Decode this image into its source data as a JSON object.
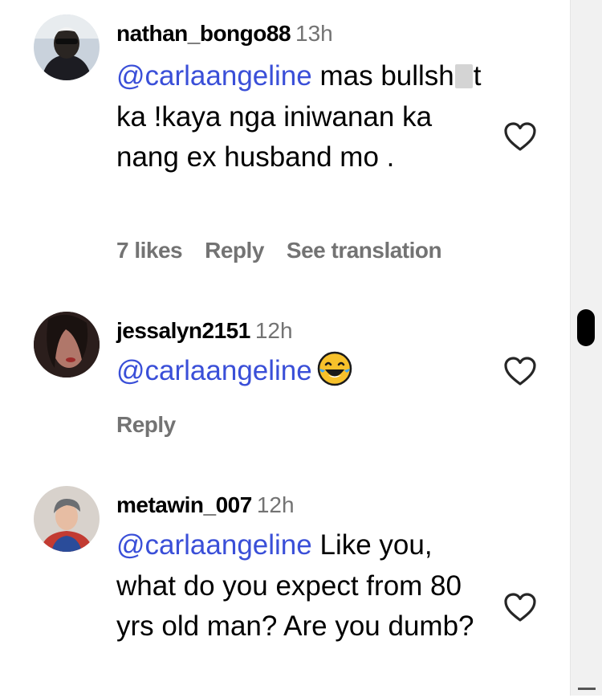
{
  "comments": [
    {
      "username": "nathan_bongo88",
      "time": "13h",
      "mention": "@carlaangeline",
      "text_part1": " mas bullsh",
      "text_part2": "t ka !kaya nga iniwanan ka nang ex husband mo .",
      "likes": "7 likes",
      "reply": "Reply",
      "translation": "See translation"
    },
    {
      "username": "jessalyn2151",
      "time": "12h",
      "mention": "@carlaangeline",
      "emoji": "tears-of-joy-emoji",
      "reply": "Reply"
    },
    {
      "username": "metawin_007",
      "time": "12h",
      "mention": "@carlaangeline",
      "text": " Like you, what do you expect from 80 yrs old man? Are you dumb?"
    }
  ],
  "colors": {
    "mention": "#3a4fd8",
    "secondary_text": "#737373",
    "scroll_thumb": "#000000"
  },
  "icons": [
    "heart-outline-icon",
    "tears-of-joy-emoji"
  ]
}
